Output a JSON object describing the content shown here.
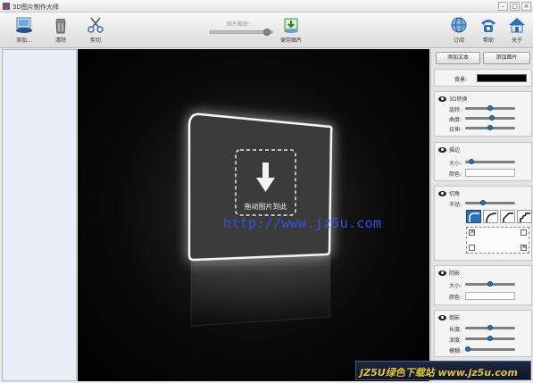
{
  "window": {
    "title": "3D图片制作大师",
    "controls": [
      "minimize",
      "maximize",
      "close"
    ]
  },
  "toolbar": {
    "left_buttons": [
      {
        "label": "添加...",
        "icon": "add-image-icon"
      },
      {
        "label": "清除",
        "icon": "trash-icon"
      },
      {
        "label": "剪切",
        "icon": "scissors-icon"
      }
    ],
    "zoom_label": "图片缩放:",
    "zoom_level": 0.85,
    "save_label": "保存图片",
    "right_buttons": [
      {
        "label": "订阅",
        "icon": "globe-icon"
      },
      {
        "label": "帮助",
        "icon": "phone-icon"
      },
      {
        "label": "关于",
        "icon": "home-icon"
      }
    ]
  },
  "canvas": {
    "drop_text": "拖动图片到此",
    "watermark": "http://www.jz5u.com"
  },
  "panel": {
    "add_text_button": "添加文本",
    "add_image_button": "添加图片",
    "background_label": "背景:",
    "background_color": "#000000",
    "rotate": {
      "title": "3D转换",
      "rows": [
        {
          "label": "旋转:",
          "value": 0.5
        },
        {
          "label": "曲度:",
          "value": 0.55
        },
        {
          "label": "拉伸:",
          "value": 0.5
        }
      ]
    },
    "border": {
      "title": "描边",
      "size_label": "大小:",
      "size_value": 0.1,
      "color_label": "颜色:"
    },
    "corner": {
      "title": "切角",
      "radius_label": "半径:",
      "radius_value": 0.35,
      "styles": [
        "round",
        "round-outer",
        "bevel",
        "step"
      ],
      "corners_checked": [
        true,
        false,
        false,
        true
      ]
    },
    "shadow": {
      "title": "阴影",
      "size_label": "大小:",
      "size_value": 0.5,
      "color_label": "颜色:"
    },
    "reflection": {
      "title": "倒影",
      "rows": [
        {
          "label": "长度:",
          "value": 0.5
        },
        {
          "label": "深度:",
          "value": 0.5
        },
        {
          "label": "模糊:",
          "value": 0.0
        }
      ]
    }
  },
  "site_watermark": "JZ5U绿色下载站 www.jz5u.com"
}
